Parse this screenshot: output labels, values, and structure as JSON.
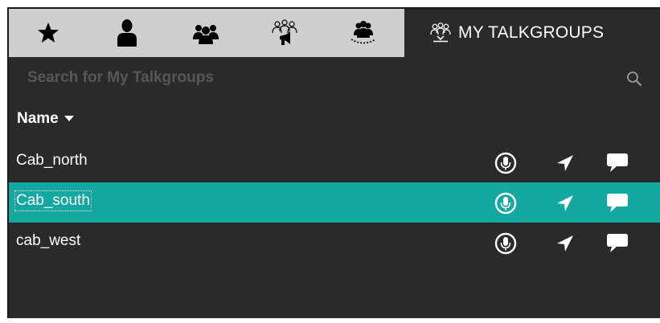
{
  "tabs": [
    {
      "id": "favorites",
      "icon": "star-icon",
      "active": false
    },
    {
      "id": "contacts",
      "icon": "person-icon",
      "active": false
    },
    {
      "id": "groups",
      "icon": "group-icon",
      "active": false
    },
    {
      "id": "broadcast",
      "icon": "broadcast-group-icon",
      "active": false
    },
    {
      "id": "scan",
      "icon": "scan-group-icon",
      "active": false
    },
    {
      "id": "my-talkgroups",
      "icon": "my-talkgroups-icon",
      "active": true,
      "label": "MY TALKGROUPS"
    }
  ],
  "search": {
    "placeholder": "Search for My Talkgroups",
    "value": ""
  },
  "list": {
    "column_header": "Name",
    "sort": "descending",
    "rows": [
      {
        "name": "Cab_north",
        "selected": false
      },
      {
        "name": "Cab_south",
        "selected": true
      },
      {
        "name": "cab_west",
        "selected": false
      }
    ]
  },
  "colors": {
    "background": "#2a2a2a",
    "tabbar": "#cfcfcf",
    "selected_row": "#13a9a2",
    "text": "#ffffff"
  }
}
